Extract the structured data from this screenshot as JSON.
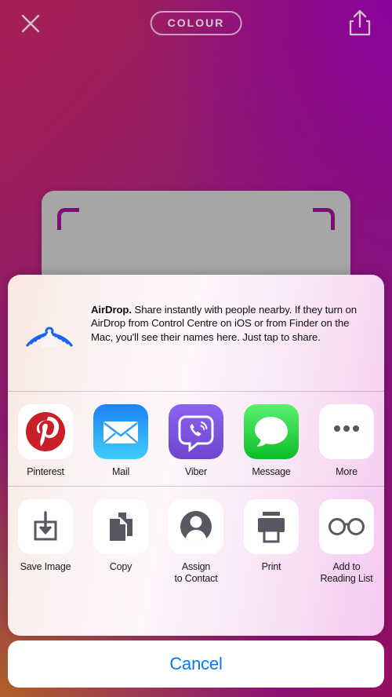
{
  "topbar": {
    "close_icon": "close-icon",
    "title_pill": "COLOUR",
    "share_icon": "share-icon"
  },
  "preview": {
    "label": "image-preview-card"
  },
  "share_sheet": {
    "airdrop": {
      "icon": "airdrop-icon",
      "title": "AirDrop.",
      "body": " Share instantly with people nearby. If they turn on AirDrop from Control Centre on iOS or from Finder on the Mac, you'll see their names here. Just tap to share."
    },
    "apps": [
      {
        "label": "Pinterest",
        "icon": "pinterest-icon"
      },
      {
        "label": "Mail",
        "icon": "mail-icon"
      },
      {
        "label": "Viber",
        "icon": "viber-icon"
      },
      {
        "label": "Message",
        "icon": "message-icon"
      },
      {
        "label": "More",
        "icon": "more-icon"
      }
    ],
    "actions": [
      {
        "label": "Save Image",
        "icon": "save-image-icon"
      },
      {
        "label": "Copy",
        "icon": "copy-icon"
      },
      {
        "label": "Assign\nto Contact",
        "icon": "assign-to-contact-icon"
      },
      {
        "label": "Print",
        "icon": "print-icon"
      },
      {
        "label": "Add to\nReading List",
        "icon": "add-to-reading-list-icon"
      }
    ]
  },
  "cancel": {
    "label": "Cancel"
  },
  "colors": {
    "cancel_text": "#007aff",
    "airdrop_blue": "#1464f6",
    "pinterest_red": "#cb1f27",
    "message_green": "#2fd159",
    "viber_purple": "#7a50d8",
    "action_gray": "#585862",
    "preview_card": "#a6a6a6",
    "preview_corner": "#7a0f78"
  }
}
